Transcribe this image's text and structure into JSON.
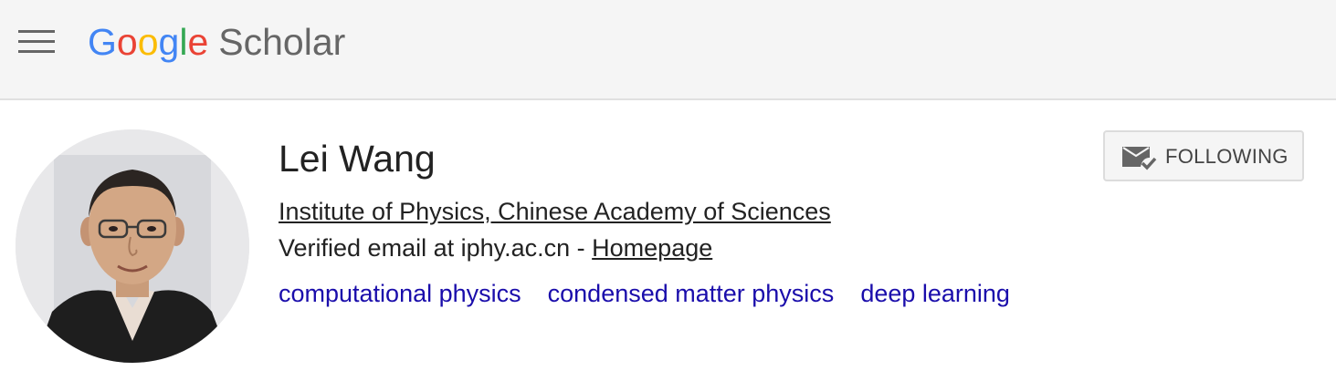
{
  "header": {
    "logo_letters": [
      "G",
      "o",
      "o",
      "g",
      "l",
      "e"
    ],
    "logo_colors": [
      "#4285F4",
      "#EA4335",
      "#FBBC05",
      "#4285F4",
      "#34A853",
      "#EA4335"
    ],
    "product": "Scholar",
    "menu_icon": "hamburger-menu-icon"
  },
  "profile": {
    "name": "Lei Wang",
    "affiliation": "Institute of Physics, Chinese Academy of Sciences",
    "email_text": "Verified email at iphy.ac.cn - ",
    "homepage_label": "Homepage",
    "interests": [
      "computational physics",
      "condensed matter physics",
      "deep learning"
    ]
  },
  "follow_button": {
    "label": "FOLLOWING",
    "icon": "email-check-icon"
  },
  "colors": {
    "link": "#1a0dab",
    "topbar_bg": "#f5f5f5"
  }
}
